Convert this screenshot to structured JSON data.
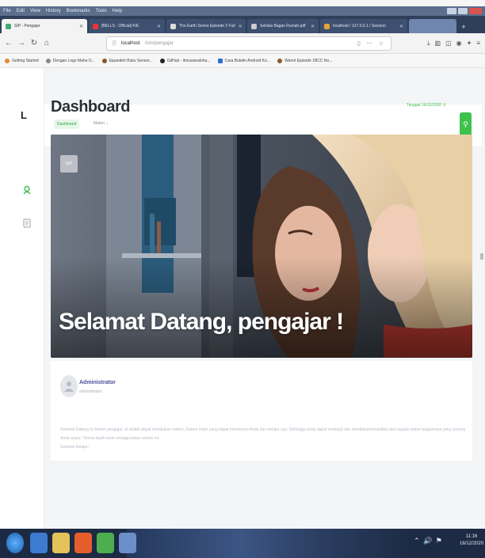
{
  "browser": {
    "menu": [
      "File",
      "Edit",
      "View",
      "History",
      "Bookmarks",
      "Tools",
      "Help"
    ],
    "tabs": [
      {
        "label": "SIP - Pengajar",
        "active": true
      },
      {
        "label": "[BELLS - Official] KIE",
        "active": false
      },
      {
        "label": "The Earth Series Episode 2 Full",
        "active": false
      },
      {
        "label": "Sekilas Bagas Rumah.pdf",
        "active": false
      },
      {
        "label": "localhost / 127.0.0.1 / Session",
        "active": false
      },
      {
        "label": "",
        "active": false
      }
    ],
    "url_host": "localhost",
    "url_path": "/sim/pengajar",
    "bookmarks": [
      "Getting Started",
      "Dengan Logo Mahe D...",
      "Ejaandeh Buku Sensor...",
      "GitHub - ilmuwanaloha...",
      "Cara Buletin Android Ko...",
      "Wanot Episode 1BCC No..."
    ]
  },
  "app": {
    "logo": "L",
    "header": {
      "crumb_active": "Dashboard",
      "crumb_second": "Materi ⌄"
    },
    "page_title": "Dashboard",
    "date_chip": "Tanggal 16/12/2020",
    "hero": {
      "badge": "SIP",
      "title": "Selamat Datang, pengajar !"
    },
    "card": {
      "name": "Administrator",
      "role": "administrator",
      "message": "Selamat Datang di Sistem pengajar, di sinilah dapat melakukan materi, Sistem inilah yang dapat membantu Anda dan belajar nya. Sehingga anda dapat melanjut dan mendokumentasikan dari segala materi bagaimana yang sedang Anda ampu. Terima kasih telah menggunakan sistem ini.",
      "footer": "Selamat belajar !"
    }
  },
  "taskbar": {
    "tray": "⌃ 🔊 ⚑",
    "time": "11:16",
    "date": "16/12/2020"
  },
  "colors": {
    "accent_green": "#3ec24d",
    "chrome_dark": "#2f3f5a",
    "title_dark": "#2b2f36"
  }
}
